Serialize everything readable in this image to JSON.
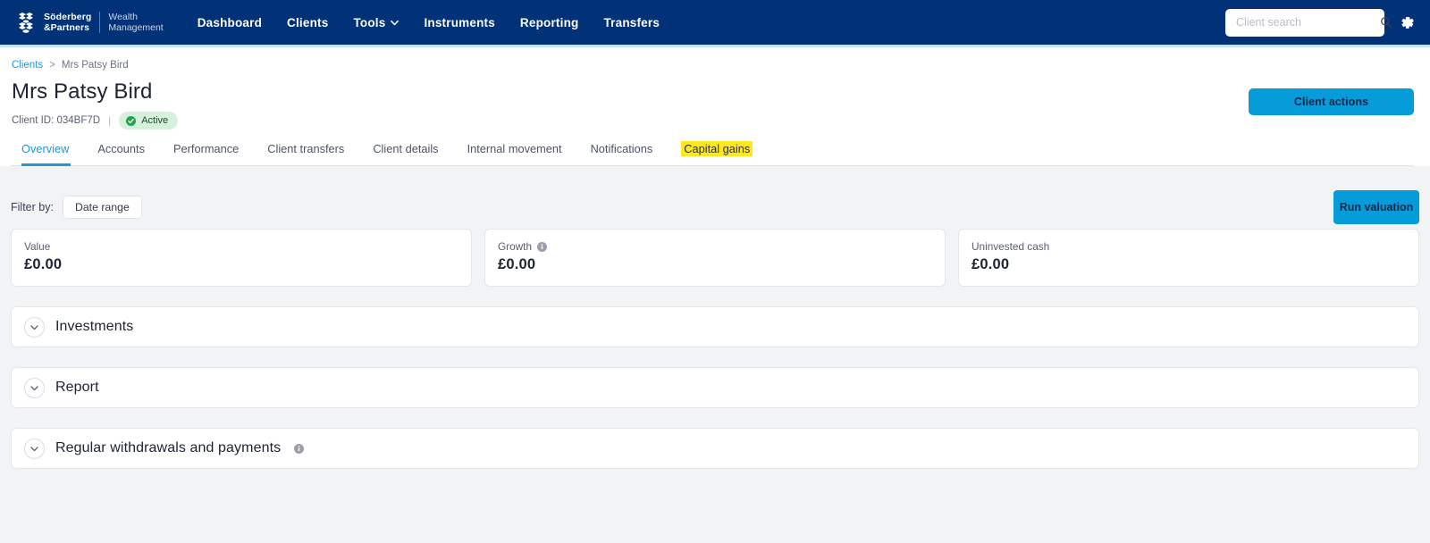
{
  "topnav": {
    "logo": {
      "icon": "soderberg-partners-crest-icon",
      "primary": "Söderberg\n&Partners",
      "primary_line1": "Söderberg",
      "primary_line2": "&Partners",
      "secondary_line1": "Wealth",
      "secondary_line2": "Management"
    },
    "links": [
      {
        "label": "Dashboard",
        "has_caret": false
      },
      {
        "label": "Clients",
        "has_caret": false
      },
      {
        "label": "Tools",
        "has_caret": true
      },
      {
        "label": "Instruments",
        "has_caret": false
      },
      {
        "label": "Reporting",
        "has_caret": false
      },
      {
        "label": "Transfers",
        "has_caret": false
      }
    ],
    "search": {
      "placeholder": "Client search",
      "value": "",
      "icon": "search-icon"
    },
    "settings_icon": "gear-icon",
    "bg_color": "#013278",
    "accent_color": "#bfe4f7"
  },
  "breadcrumb": {
    "root": "Clients",
    "separator": ">",
    "current": "Mrs Patsy Bird"
  },
  "client": {
    "name": "Mrs Patsy Bird",
    "id_label": "Client ID: 034BF7D",
    "separator": "|",
    "status": "Active",
    "status_icon": "check-circle-icon",
    "status_bg": "#d6f0de",
    "status_text_color": "#1d4a2a"
  },
  "actions": {
    "client_actions_label": "Client actions",
    "run_valuation_label": "Run valuation",
    "primary_color": "#069bd9"
  },
  "tabs": [
    {
      "label": "Overview",
      "active": true,
      "highlight": false
    },
    {
      "label": "Accounts",
      "active": false,
      "highlight": false
    },
    {
      "label": "Performance",
      "active": false,
      "highlight": false
    },
    {
      "label": "Client transfers",
      "active": false,
      "highlight": false
    },
    {
      "label": "Client details",
      "active": false,
      "highlight": false
    },
    {
      "label": "Internal movement",
      "active": false,
      "highlight": false
    },
    {
      "label": "Notifications",
      "active": false,
      "highlight": false
    },
    {
      "label": "Capital gains",
      "active": false,
      "highlight": true
    }
  ],
  "filter": {
    "label": "Filter by:",
    "date_range_label": "Date range"
  },
  "stats": [
    {
      "label": "Value",
      "value": "£0.00",
      "has_info": false
    },
    {
      "label": "Growth",
      "value": "£0.00",
      "has_info": true
    },
    {
      "label": "Uninvested cash",
      "value": "£0.00",
      "has_info": false
    }
  ],
  "accordions": [
    {
      "title": "Investments",
      "has_info": false,
      "icon": "chevron-down-icon"
    },
    {
      "title": "Report",
      "has_info": false,
      "icon": "chevron-down-icon"
    },
    {
      "title": "Regular withdrawals and payments",
      "has_info": true,
      "icon": "chevron-down-icon"
    }
  ],
  "colors": {
    "nav_bg": "#013278",
    "accent_blue": "#2196d8",
    "button_blue": "#069bd9",
    "highlight_yellow": "#ffe81e",
    "page_bg": "#f2f3f5"
  }
}
